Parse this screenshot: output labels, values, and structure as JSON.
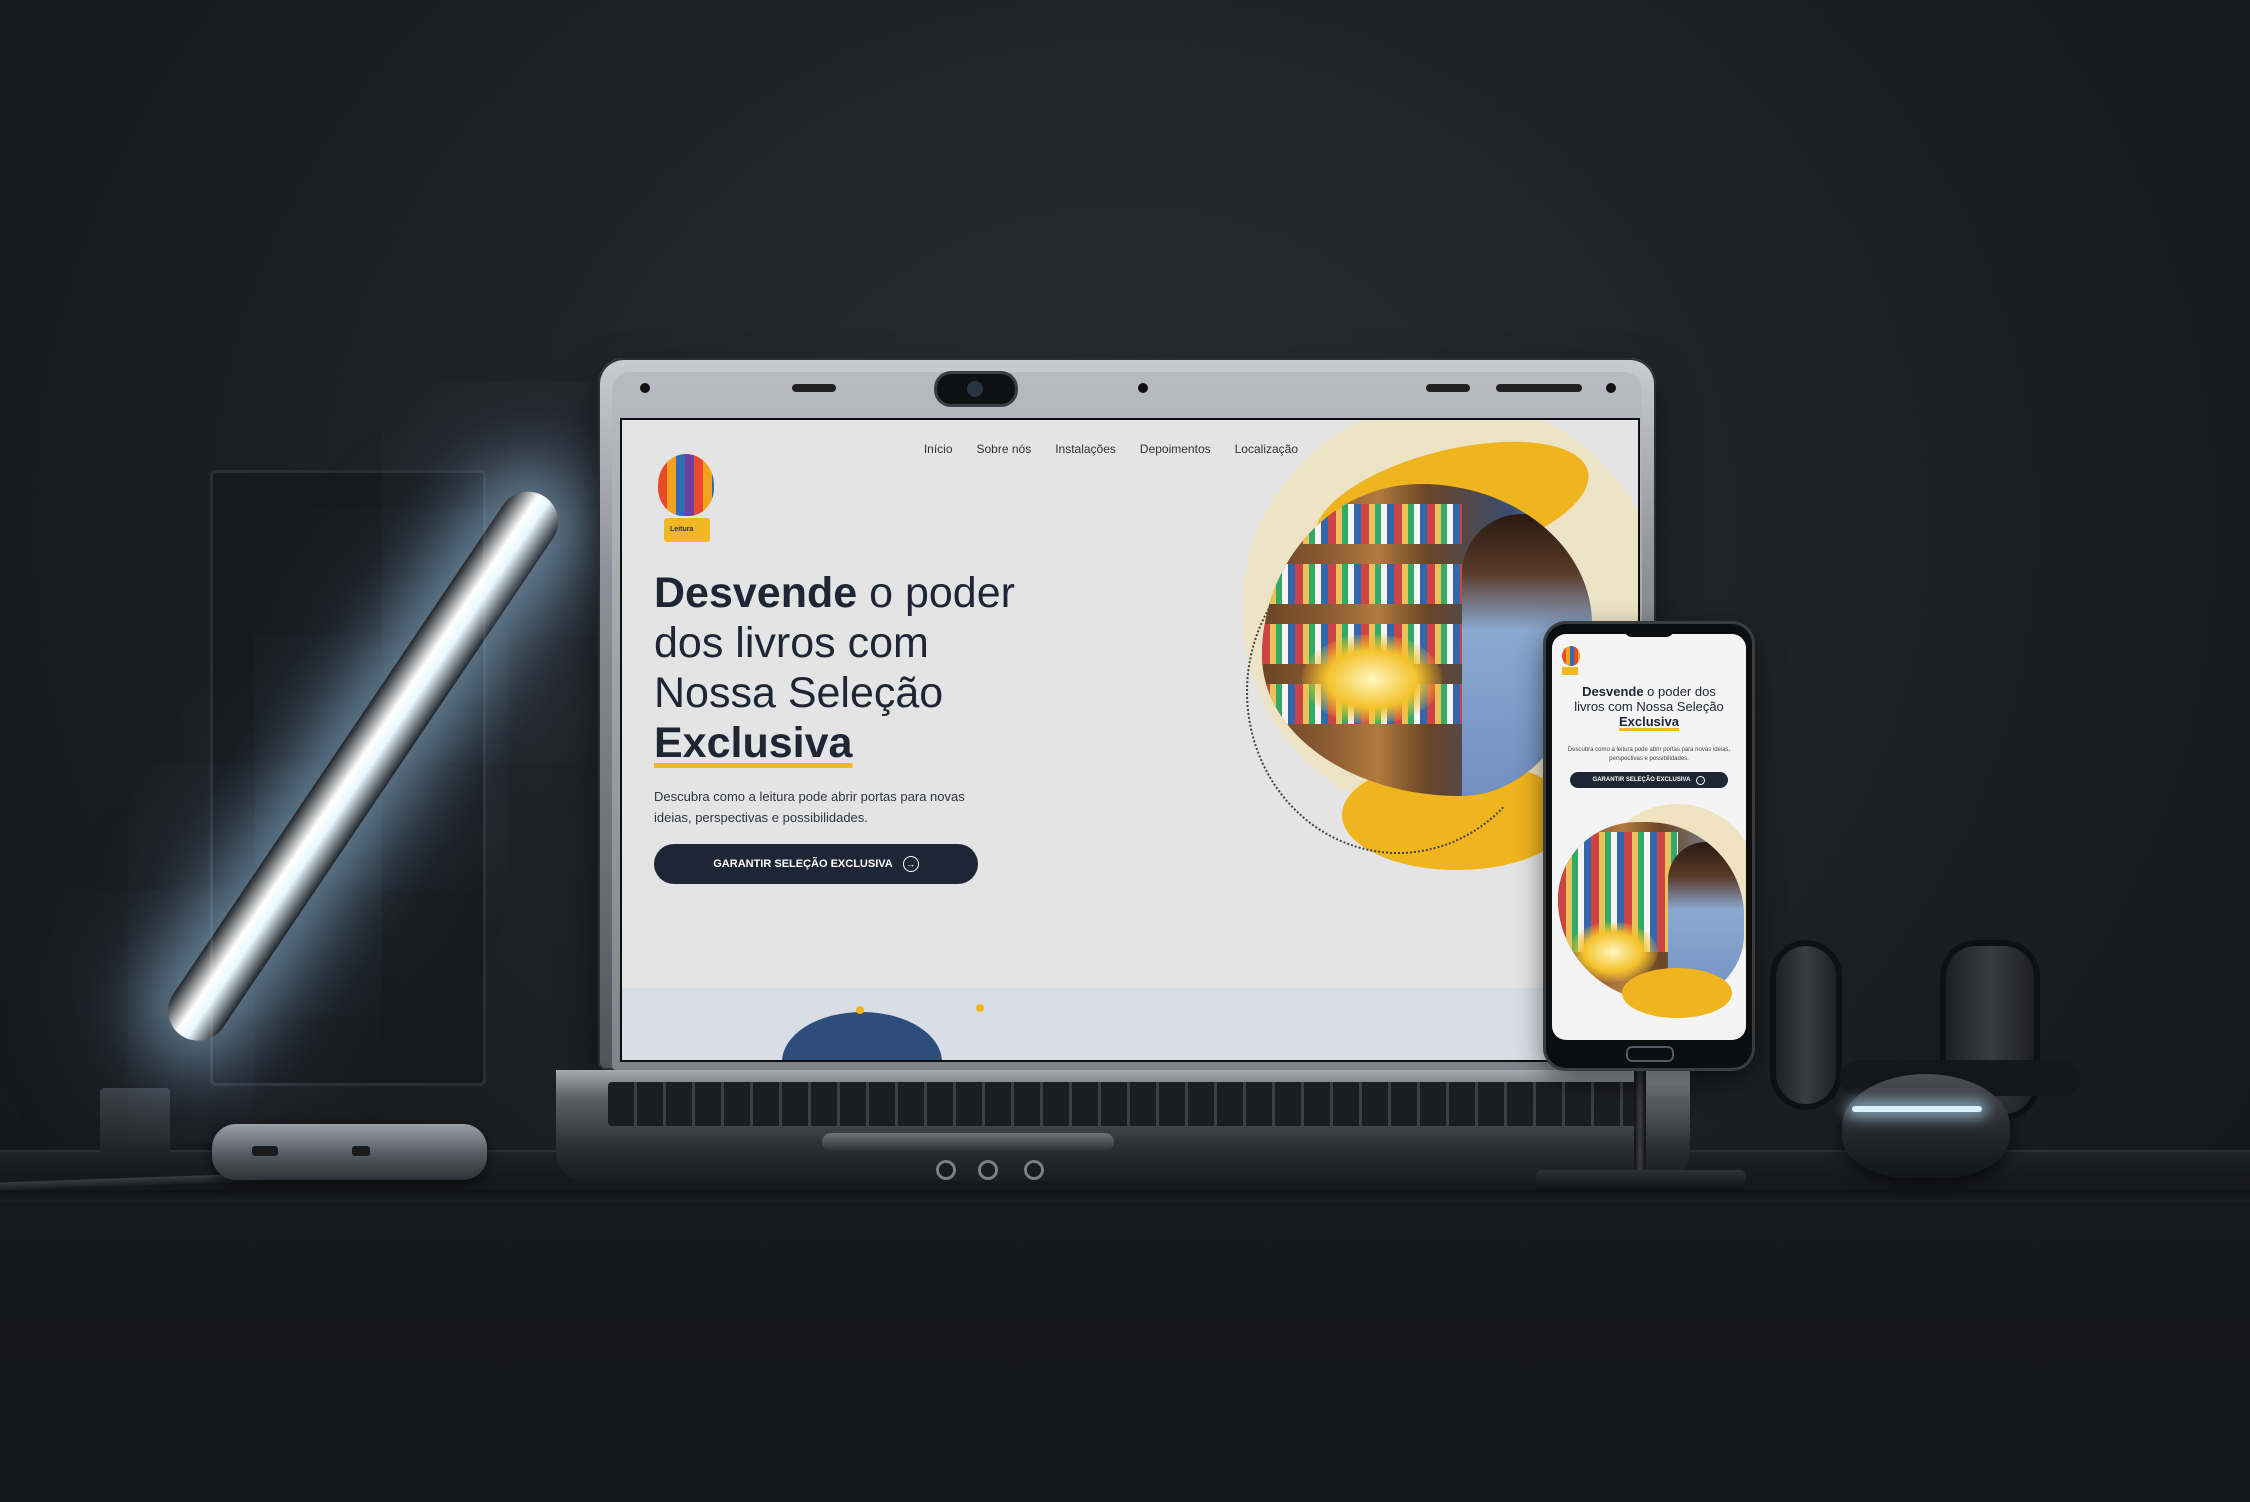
{
  "site": {
    "logo_text": "Leitura",
    "nav": [
      "Início",
      "Sobre nós",
      "Instalações",
      "Depoimentos",
      "Localização"
    ],
    "headline": {
      "bold_start": "Desvende",
      "rest_line1": " o poder",
      "line2": "dos livros com",
      "line3": "Nossa Seleção",
      "bold_end": "Exclusiva"
    },
    "subtext": "Descubra como a leitura pode abrir portas para novas ideias, perspectivas e possibilidades.",
    "cta_label": "GARANTIR SELEÇÃO EXCLUSIVA",
    "cta_icon": "arrow-right-circle-icon"
  },
  "phone": {
    "headline": {
      "bold_start": "Desvende",
      "rest_line1": " o poder dos",
      "line2": "livros com Nossa Seleção",
      "bold_end": "Exclusiva"
    },
    "subtext": "Descubra como a leitura pode abrir portas para novas ideias, perspectivas e possibilidades.",
    "cta_label": "GARANTIR SELEÇÃO EXCLUSIVA"
  },
  "colors": {
    "navy": "#1e2534",
    "accent_yellow": "#f0b41f",
    "cream": "#efe3c0",
    "blue_blob": "#2d4d7a"
  }
}
